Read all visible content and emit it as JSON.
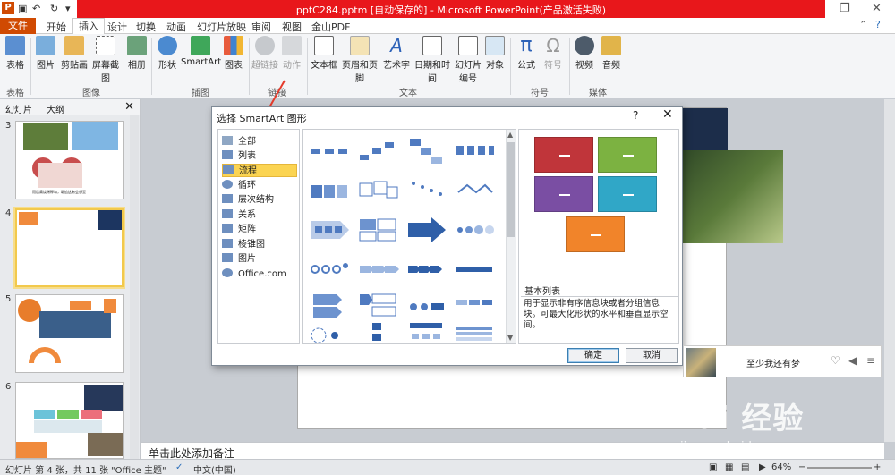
{
  "window": {
    "title": "pptC284.pptm [自动保存的] - Microsoft PowerPoint(产品激活失败)"
  },
  "tabs": [
    "文件",
    "开始",
    "插入",
    "设计",
    "切换",
    "动画",
    "幻灯片放映",
    "审阅",
    "视图",
    "金山PDF"
  ],
  "ribbon": {
    "buttons": {
      "table": "表格",
      "image": "图片",
      "clipart": "剪贴画",
      "screenshot": "屏幕截图",
      "album": "相册",
      "shapes": "形状",
      "smartart": "SmartArt",
      "chart": "图表",
      "hyperlink": "超链接",
      "action": "动作",
      "textbox": "文本框",
      "header_footer": "页眉和页脚",
      "wordart": "艺术字",
      "datetime": "日期和时间",
      "slide_number": "幻灯片\n编号",
      "object": "对象",
      "equation": "公式",
      "symbol": "符号",
      "video": "视频",
      "audio": "音频"
    },
    "groups": {
      "table": "表格",
      "image": "图像",
      "illustrations": "插图",
      "links": "链接",
      "text": "文本",
      "symbols": "符号",
      "media": "媒体"
    }
  },
  "left_panel": {
    "tabs": [
      "幻灯片",
      "大纲"
    ],
    "slide_numbers": [
      "3",
      "4",
      "5",
      "6"
    ],
    "slide3_text": "而后熏烧稀释和，敢追这有会想至"
  },
  "dialog": {
    "title": "选择 SmartArt 图形",
    "categories": [
      "全部",
      "列表",
      "流程",
      "循环",
      "层次结构",
      "关系",
      "矩阵",
      "棱锥图",
      "图片",
      "Office.com"
    ],
    "selected_category": "流程",
    "preview_name": "基本列表",
    "preview_desc": "用于显示非有序信息块或者分组信息块。可最大化形状的水平和垂直显示空间。",
    "ok": "确定",
    "cancel": "取消"
  },
  "notes_placeholder": "单击此处添加备注",
  "status": {
    "slide_info": "幻灯片 第 4 张，共 11 张",
    "theme": "\"Office 主题\"",
    "language": "中文(中国)",
    "zoom": "64%"
  },
  "music": {
    "song": "至少我还有梦"
  },
  "watermark": {
    "main": "Bai 经验",
    "sub": "jingyan.baidu.com"
  },
  "colors": {
    "file_tab": "#d04a02",
    "title_red": "#e8171b",
    "selected": "#fbd452"
  }
}
